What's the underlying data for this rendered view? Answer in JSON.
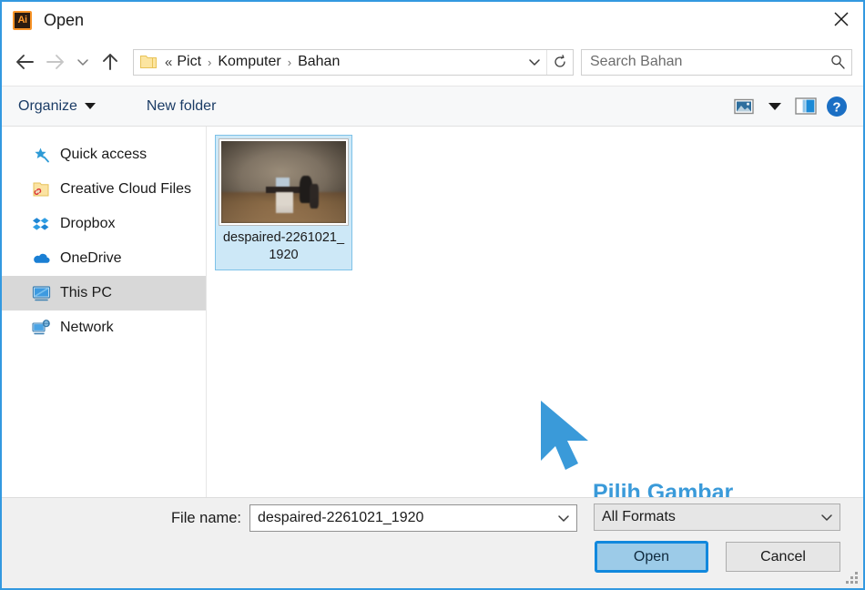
{
  "window": {
    "app_icon": "illustrator-ai-icon",
    "title": "Open",
    "close_label": "✕",
    "accent_color": "#3399e0"
  },
  "nav": {
    "back_label": "back-arrow",
    "forward_label": "forward-arrow",
    "recent_label": "recent-locations-chevron",
    "up_label": "up-arrow"
  },
  "address": {
    "folder_icon": "folder-icon",
    "overflow": "«",
    "crumbs": [
      "Pict",
      "Komputer",
      "Bahan"
    ],
    "separator": "›",
    "dropdown_icon": "chevron-down-icon",
    "refresh_icon": "refresh-icon"
  },
  "search": {
    "placeholder": "Search Bahan",
    "value": "",
    "icon": "search-icon"
  },
  "toolbar": {
    "organize_label": "Organize",
    "new_folder_label": "New folder",
    "view_icon": "picture-view-icon",
    "view_caret_icon": "chevron-down-icon",
    "preview_pane_icon": "preview-pane-icon",
    "help_icon": "help-question-icon",
    "help_label": "?"
  },
  "sidebar": {
    "items": [
      {
        "label": "Quick access",
        "icon": "star-pin-icon",
        "selected": false
      },
      {
        "label": "Creative Cloud Files",
        "icon": "creative-cloud-icon",
        "selected": false
      },
      {
        "label": "Dropbox",
        "icon": "dropbox-icon",
        "selected": false
      },
      {
        "label": "OneDrive",
        "icon": "onedrive-cloud-icon",
        "selected": false
      },
      {
        "label": "This PC",
        "icon": "this-pc-monitor-icon",
        "selected": true
      },
      {
        "label": "Network",
        "icon": "network-icon",
        "selected": false
      }
    ]
  },
  "content": {
    "files": [
      {
        "name": "despaired-2261021_1920",
        "selected": true,
        "thumbnail": "desk-scene-photo"
      }
    ]
  },
  "annotation": {
    "cursor_icon": "mouse-pointer-arrow",
    "text": "Pilih Gambar",
    "color": "#3a9ad9"
  },
  "footer": {
    "filename_label": "File name:",
    "filename_value": "despaired-2261021_1920",
    "filename_caret_icon": "chevron-down-icon",
    "format_value": "All Formats",
    "format_caret_icon": "chevron-down-icon",
    "open_label": "Open",
    "cancel_label": "Cancel",
    "resize_grip": "resize-grip"
  }
}
